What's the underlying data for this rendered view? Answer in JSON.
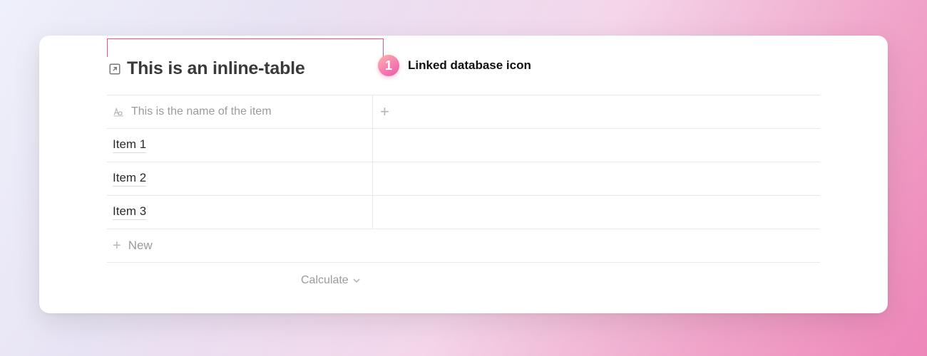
{
  "callout": {
    "badge": "1",
    "label": "Linked database icon"
  },
  "table": {
    "title": "This is an inline-table",
    "name_column_header": "This is the name of the item",
    "rows": [
      {
        "name": "Item 1"
      },
      {
        "name": "Item 2"
      },
      {
        "name": "Item 3"
      }
    ],
    "new_row_label": "New",
    "calculate_label": "Calculate"
  }
}
